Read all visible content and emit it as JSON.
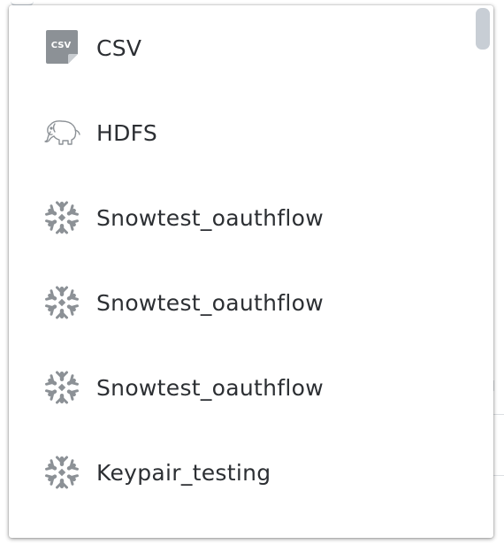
{
  "connectors": [
    {
      "label": "CSV",
      "icon": "csv-file-icon",
      "icon_text": "CSV"
    },
    {
      "label": "HDFS",
      "icon": "hadoop-elephant-icon"
    },
    {
      "label": "Snowtest_oauthflow",
      "icon": "snowflake-icon"
    },
    {
      "label": "Snowtest_oauthflow",
      "icon": "snowflake-icon"
    },
    {
      "label": "Snowtest_oauthflow",
      "icon": "snowflake-icon"
    },
    {
      "label": "Keypair_testing",
      "icon": "snowflake-icon"
    }
  ],
  "colors": {
    "label_text": "#2c2f33",
    "icon_gray": "#8c9196",
    "scrollbar_thumb": "#c8ced5"
  }
}
